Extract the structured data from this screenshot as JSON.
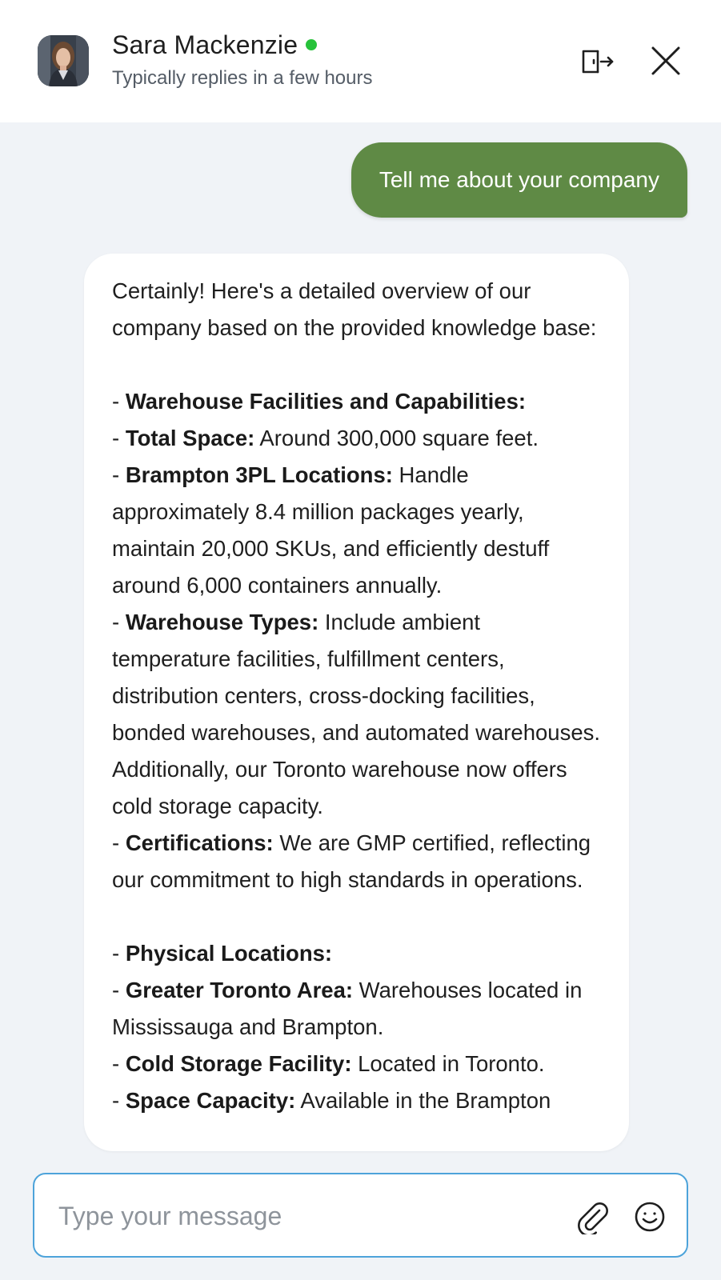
{
  "header": {
    "agent_name": "Sara Mackenzie",
    "status_text": "Typically replies in a few hours",
    "online_color": "#27c23a",
    "icons": {
      "exit": "exit-chat-icon",
      "close": "close-icon"
    }
  },
  "messages": [
    {
      "role": "user",
      "text": "Tell me about your company"
    },
    {
      "role": "agent",
      "intro": "Certainly! Here's a detailed overview of our company based on the provided knowledge base:",
      "sections": [
        {
          "heading": "Warehouse Facilities and Capabilities:",
          "items": [
            {
              "label": "Total Space:",
              "text": " Around 300,000 square feet."
            },
            {
              "label": "Brampton 3PL Locations:",
              "text": " Handle approximately 8.4 million packages yearly, maintain 20,000 SKUs, and efficiently destuff around 6,000 containers annually."
            },
            {
              "label": "Warehouse Types:",
              "text": " Include ambient temperature facilities, fulfillment centers, distribution centers, cross-docking facilities, bonded warehouses, and automated warehouses. Additionally, our Toronto warehouse now offers cold storage capacity."
            },
            {
              "label": "Certifications:",
              "text": " We are GMP certified, reflecting our commitment to high standards in operations."
            }
          ]
        },
        {
          "heading": "Physical Locations:",
          "items": [
            {
              "label": "Greater Toronto Area:",
              "text": " Warehouses located in Mississauga and Brampton."
            },
            {
              "label": "Cold Storage Facility:",
              "text": " Located in Toronto."
            },
            {
              "label": "Space Capacity:",
              "text": " Available in the Brampton"
            }
          ]
        }
      ]
    }
  ],
  "composer": {
    "placeholder": "Type your message",
    "icons": {
      "attach": "paperclip-icon",
      "emoji": "emoji-icon"
    }
  },
  "colors": {
    "user_bubble": "#5f8a45",
    "background": "#f0f3f7",
    "input_border": "#4da3da"
  }
}
